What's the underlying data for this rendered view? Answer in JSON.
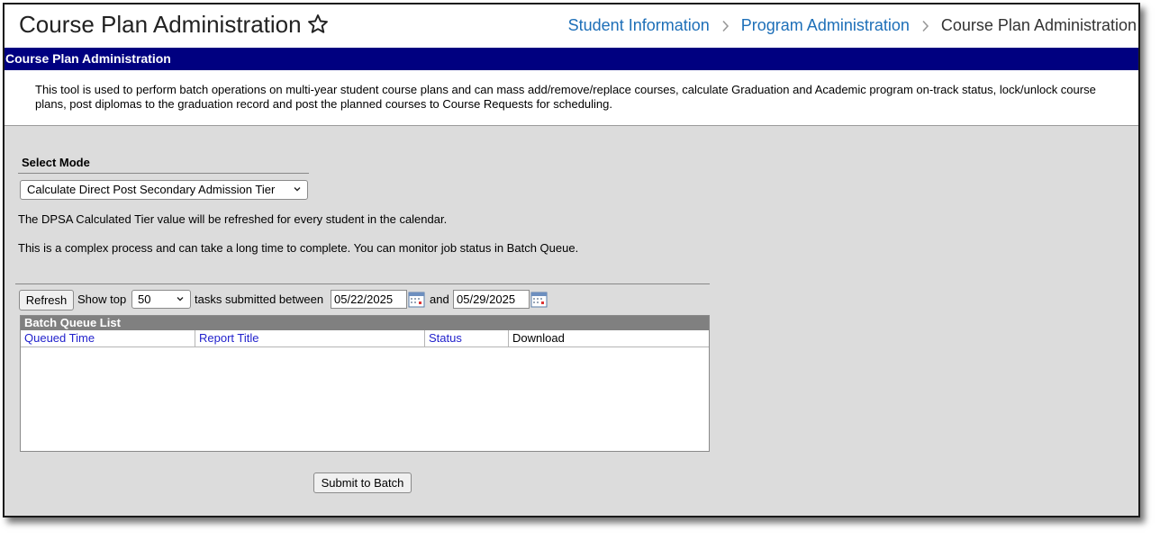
{
  "header": {
    "title": "Course Plan Administration",
    "breadcrumb": [
      "Student Information",
      "Program Administration",
      "Course Plan Administration"
    ]
  },
  "banner": {
    "title": "Course Plan Administration"
  },
  "description": "This tool is used to perform batch operations on multi-year student course plans and can mass add/remove/replace courses, calculate Graduation and Academic program on-track status, lock/unlock course plans, post diplomas to the graduation record and post the planned courses to Course Requests for scheduling.",
  "form": {
    "select_mode_label": "Select Mode",
    "mode_value": "Calculate Direct Post Secondary Admission Tier",
    "info_line1": "The DPSA Calculated Tier value will be refreshed for every student in the calendar.",
    "info_line2": "This is a complex process and can take a long time to complete. You can monitor job status in Batch Queue."
  },
  "batch": {
    "refresh_label": "Refresh",
    "show_top_label": "Show top",
    "top_count": "50",
    "tasks_label": "tasks submitted between",
    "start_date": "05/22/2025",
    "and_label": "and",
    "end_date": "05/29/2025",
    "list_title": "Batch Queue List",
    "columns": [
      "Queued Time",
      "Report Title",
      "Status",
      "Download"
    ],
    "submit_label": "Submit to Batch"
  },
  "colors": {
    "banner": "#000080",
    "breadcrumb_link": "#1d6fb8",
    "column_link": "#2222cc",
    "panel_bg": "#dcdcdc"
  },
  "icons": [
    "star-icon",
    "breadcrumb-chevron-icon",
    "dropdown-chevron-icon",
    "calendar-icon"
  ]
}
